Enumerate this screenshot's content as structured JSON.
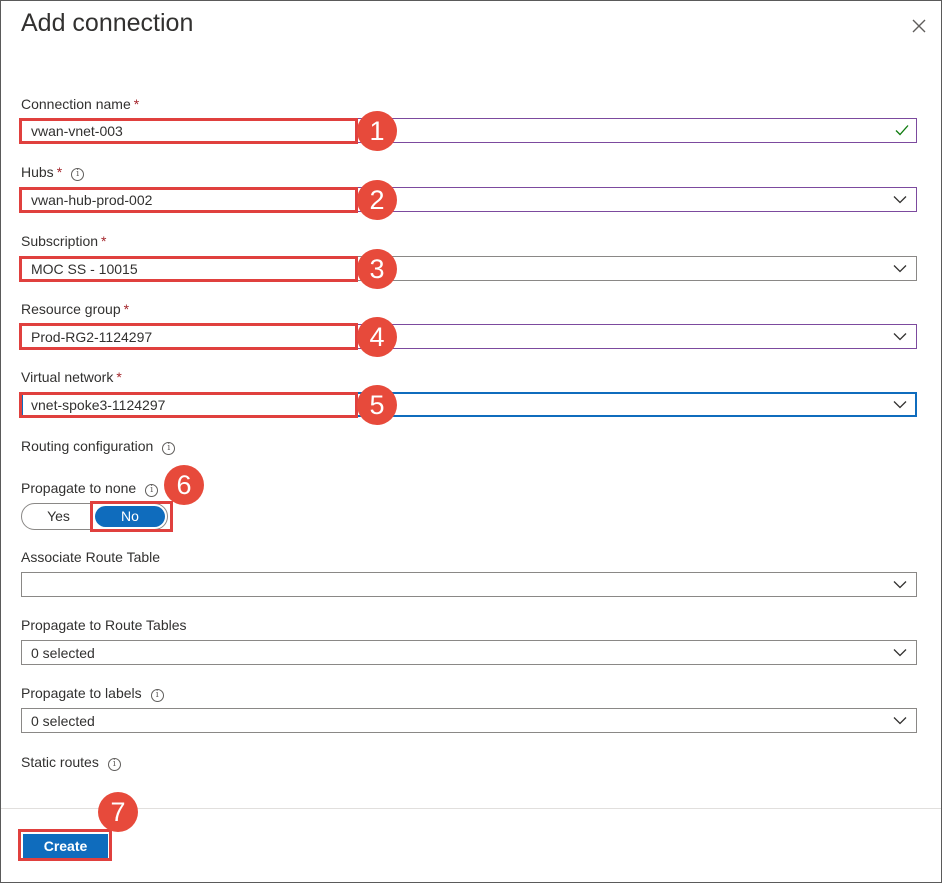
{
  "dialog": {
    "title": "Add connection",
    "close_icon": "close-icon"
  },
  "form": {
    "connection_name": {
      "label": "Connection name",
      "required": "*",
      "value": "vwan-vnet-003",
      "valid_icon": "checkmark-icon"
    },
    "hubs": {
      "label": "Hubs",
      "required": "*",
      "info": "i",
      "value": "vwan-hub-prod-002"
    },
    "subscription": {
      "label": "Subscription",
      "required": "*",
      "value": "MOC SS - 10015"
    },
    "resource_group": {
      "label": "Resource group",
      "required": "*",
      "value": "Prod-RG2-1124297"
    },
    "virtual_network": {
      "label": "Virtual network",
      "required": "*",
      "value": "vnet-spoke3-1124297"
    },
    "routing_configuration": {
      "label": "Routing configuration",
      "info": "i"
    },
    "propagate_to_none": {
      "label": "Propagate to none",
      "info": "i",
      "options": [
        "Yes",
        "No"
      ],
      "selected": "No"
    },
    "associate_route_table": {
      "label": "Associate Route Table",
      "value": ""
    },
    "propagate_to_route_tables": {
      "label": "Propagate to Route Tables",
      "value": "0 selected"
    },
    "propagate_to_labels": {
      "label": "Propagate to labels",
      "info": "i",
      "value": "0 selected"
    },
    "static_routes": {
      "label": "Static routes",
      "info": "i"
    }
  },
  "footer": {
    "create_label": "Create"
  },
  "annotations": {
    "badges": [
      "1",
      "2",
      "3",
      "4",
      "5",
      "6",
      "7"
    ],
    "highlight_color": "#e0403e",
    "badge_color": "#e74a3b"
  },
  "colors": {
    "accent": "#0f6cbd",
    "text": "#323130",
    "required": "#a4262c",
    "valid": "#107c10",
    "touched_border": "#7c4a9e"
  }
}
